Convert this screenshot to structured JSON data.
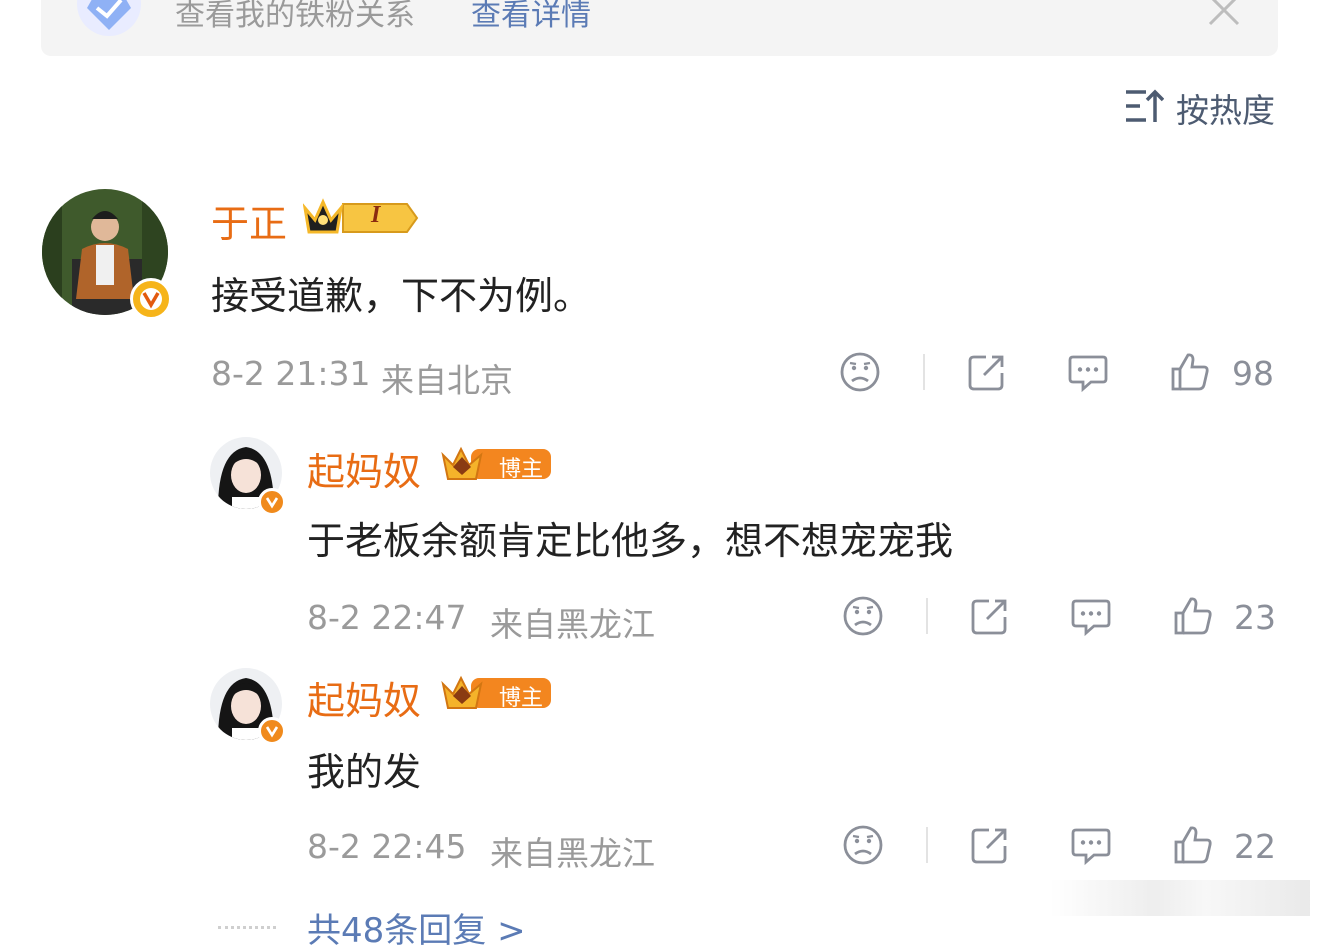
{
  "banner": {
    "text": "查看我的铁粉关系",
    "link": "查看详情",
    "close_icon": "close-icon"
  },
  "sort": {
    "label": "按热度",
    "icon": "sort-icon"
  },
  "comments": [
    {
      "user": "于正",
      "badge": "crown-level-badge",
      "badge_text": "I",
      "text": "接受道歉，下不为例。",
      "time": "8-2 21:31",
      "location": "来自北京",
      "likes": "98"
    }
  ],
  "replies": [
    {
      "user": "起妈奴",
      "badge_text": "博主",
      "text": "于老板余额肯定比他多，想不想宠宠我",
      "time": "8-2 22:47",
      "location": "来自黑龙江",
      "likes": "23"
    },
    {
      "user": "起妈奴",
      "badge_text": "博主",
      "text": "我的发",
      "time": "8-2 22:45",
      "location": "来自黑龙江",
      "likes": "22"
    }
  ],
  "more_replies": "共48条回复 >",
  "colors": {
    "username": "#e86c14",
    "link": "#5b7bb5",
    "meta": "#9a9a9a",
    "icon": "#8b8f99"
  }
}
